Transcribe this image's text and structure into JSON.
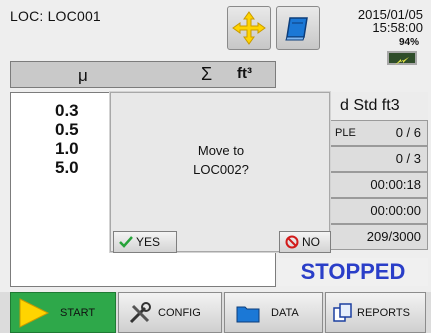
{
  "header": {
    "location": "LOC:  LOC001",
    "date": "2015/01/05",
    "time": "15:58:00",
    "battery_percent": "94%"
  },
  "table": {
    "headers": {
      "size": "μ",
      "sum": "Σ",
      "unit": "ft³"
    },
    "sizes": [
      "0.3",
      "0.5",
      "1.0",
      "5.0"
    ]
  },
  "right_panel": {
    "unit": "d Std ft3",
    "sample_label": "PLE",
    "sample_value": "0 / 6",
    "cycle_value": "0 / 3",
    "delay_value": "00:00:18",
    "duration_value": "00:00:00",
    "volume_value": "209/3000",
    "status": "STOPPED"
  },
  "dialog": {
    "message": "Move to\nLOC002?",
    "yes_label": "YES",
    "no_label": "NO"
  },
  "nav": {
    "start_label": "START",
    "config_label": "CONFIG",
    "data_label": "DATA",
    "reports_label": "REPORTS"
  },
  "colors": {
    "start_green": "#2ea84a",
    "status_blue": "#2a3ec8",
    "arrow_yellow": "#ffd400",
    "book_blue": "#1b78d6"
  },
  "icons": [
    "move-arrows-icon",
    "book-icon",
    "battery-icon",
    "check-icon",
    "no-icon",
    "play-icon",
    "tools-icon",
    "folder-icon",
    "reports-icon"
  ]
}
